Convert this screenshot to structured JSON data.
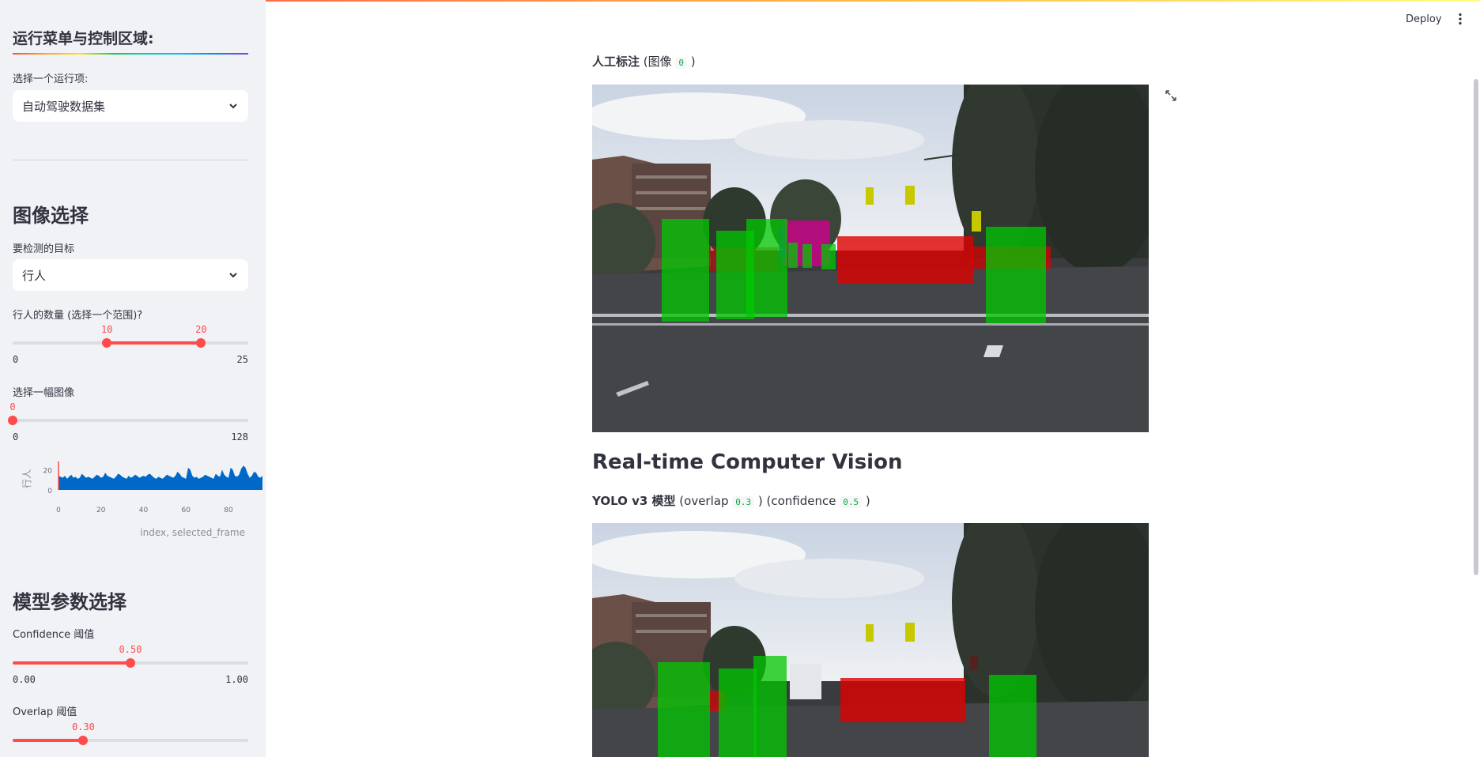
{
  "sidebar": {
    "menu_title": "运行菜单与控制区域:",
    "run_select_label": "选择一个运行项:",
    "run_select_value": "自动驾驶数据集",
    "image_section_title": "图像选择",
    "target_label": "要检测的目标",
    "target_value": "行人",
    "count_label": "行人的数量 (选择一个范围)?",
    "count_slider": {
      "low": 10,
      "high": 20,
      "min": 0,
      "max": 25,
      "low_text": "10",
      "high_text": "20",
      "min_text": "0",
      "max_text": "25"
    },
    "image_label": "选择一幅图像",
    "image_slider": {
      "value": 0,
      "min": 0,
      "max": 128,
      "value_text": "0",
      "min_text": "0",
      "max_text": "128"
    },
    "mini_chart_caption": "index, selected_frame",
    "model_section_title": "模型参数选择",
    "confidence_label": "Confidence 阈值",
    "confidence_slider": {
      "value": 0.5,
      "min": 0,
      "max": 1,
      "value_text": "0.50",
      "min_text": "0.00",
      "max_text": "1.00"
    },
    "overlap_label": "Overlap 阈值",
    "overlap_slider": {
      "value": 0.3,
      "min": 0,
      "max": 1,
      "value_text": "0.30"
    }
  },
  "chart_data": {
    "type": "area",
    "ylabel": "行人",
    "xlabel": "index, selected_frame",
    "x_ticks": [
      "0",
      "20",
      "40",
      "60",
      "80"
    ],
    "y_ticks": [
      "0",
      "20"
    ],
    "xlim": [
      0,
      96
    ],
    "ylim": [
      0,
      25
    ],
    "selected_index": 0,
    "values": [
      14,
      13,
      12,
      14,
      11,
      13,
      15,
      12,
      13,
      11,
      12,
      16,
      14,
      12,
      13,
      12,
      11,
      13,
      15,
      14,
      12,
      13,
      17,
      14,
      13,
      12,
      11,
      13,
      16,
      15,
      13,
      12,
      11,
      14,
      12,
      13,
      15,
      14,
      12,
      13,
      14,
      13,
      15,
      16,
      14,
      12,
      11,
      13,
      12,
      11,
      13,
      15,
      14,
      13,
      12,
      14,
      18,
      16,
      13,
      12,
      11,
      22,
      20,
      14,
      12,
      13,
      11,
      12,
      13,
      15,
      14,
      13,
      12,
      11,
      16,
      14,
      13,
      20,
      15,
      13,
      12,
      22,
      20,
      14,
      13,
      15,
      21,
      24,
      22,
      16,
      12,
      14,
      18,
      17,
      13,
      12,
      14
    ]
  },
  "header": {
    "deploy_label": "Deploy",
    "menu_icon": "kebab-menu-icon"
  },
  "main": {
    "annotation_caption_bold": "人工标注",
    "annotation_caption_pre": " (图像 ",
    "annotation_image_index": "0",
    "annotation_caption_post": " )",
    "section_title": "Real-time Computer Vision",
    "model_caption_bold": "YOLO v3 模型",
    "model_caption_overlap_pre": " (overlap ",
    "model_overlap_value": "0.3",
    "model_caption_confidence_pre": " ) (confidence ",
    "model_confidence_value": "0.5",
    "model_caption_post": " )"
  },
  "colors": {
    "accent": "#ff4b4b",
    "pedestrian_box": "#00c800",
    "car_box": "#e00000",
    "truck_box": "#d0008c",
    "traffic_light_box": "#c8c800",
    "chart_fill": "#0068c9"
  }
}
